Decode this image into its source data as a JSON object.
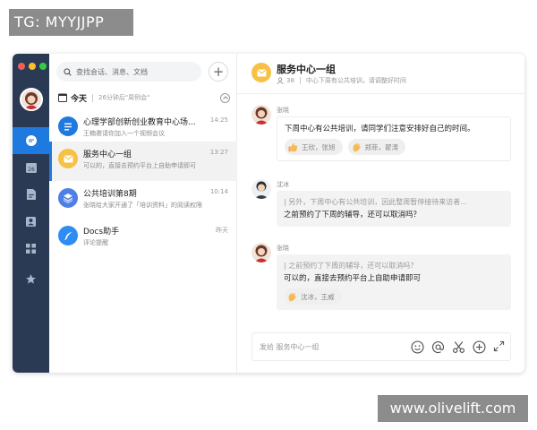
{
  "watermarks": {
    "top": "TG: MYYJJPP",
    "bottom": "www.olivelift.com"
  },
  "window": {
    "traffic_colors": [
      "#f25f58",
      "#fbbe2e",
      "#38c84a"
    ]
  },
  "rail": {
    "items": [
      {
        "name": "chat-icon",
        "active": true
      },
      {
        "name": "calendar-icon",
        "label": "26"
      },
      {
        "name": "document-icon"
      },
      {
        "name": "contacts-icon"
      },
      {
        "name": "apps-grid-icon"
      },
      {
        "name": "star-icon"
      }
    ]
  },
  "list": {
    "search_placeholder": "查找会话、消息、文档",
    "add_label": "+",
    "today": {
      "label": "今天",
      "subtitle": "26分钟后\"周例会\""
    },
    "conversations": [
      {
        "icon": "doc-lines-icon",
        "color": "#1f7ae0",
        "title": "心理学部创新创业教育中心场...",
        "time": "14:25",
        "preview": "王楠邀请你加入一个视频会议"
      },
      {
        "icon": "envelope-icon",
        "color": "#f7c145",
        "title": "服务中心一组",
        "time": "13:27",
        "preview": "可以的，直接去预约平台上自助申请即可",
        "selected": true
      },
      {
        "icon": "layers-icon",
        "color": "#4d7fe6",
        "title": "公共培训第8期",
        "time": "10:14",
        "preview": "张晓给大家开通了「培训资料」的阅读权限"
      },
      {
        "icon": "feather-icon",
        "color": "#2f8cf2",
        "title": "Docs助手",
        "time": "昨天",
        "preview": "评论提醒"
      }
    ]
  },
  "chat": {
    "title": "服务中心一组",
    "member_count": "38",
    "announcement": "中心下周有公共培训，请调整好时间",
    "messages": [
      {
        "sender": "张晓",
        "text": "下周中心有公共培训，请同学们注意安排好自己的时间。",
        "reactions": [
          {
            "emoji": "thumbs-up-icon",
            "names": "王欣，张旭"
          },
          {
            "emoji": "wave-icon",
            "names": "郑菲，翟涛"
          }
        ]
      },
      {
        "sender": "沈冰",
        "quote": "| 另外，下周中心有公共培训，因此整周暂停接待来访者...",
        "text": "之前预约了下周的辅导，还可以取消吗？"
      },
      {
        "sender": "张晓",
        "quote": "| 之前预约了下周的辅导，还可以取消吗？",
        "text": "可以的，直接去预约平台上自助申请即可",
        "reactions": [
          {
            "emoji": "clap-icon",
            "names": "沈冰，王威"
          }
        ]
      }
    ],
    "composer_placeholder": "发给 服务中心一组"
  }
}
